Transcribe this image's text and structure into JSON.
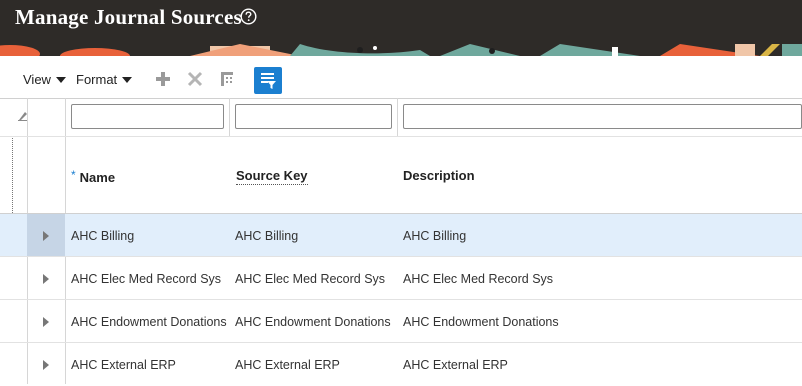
{
  "page": {
    "title": "Manage Journal Sources",
    "help_icon": "help-circle-icon"
  },
  "toolbar": {
    "view_label": "View",
    "format_label": "Format",
    "icons": [
      "add-icon",
      "delete-icon",
      "freeze-icon",
      "query-by-example-icon"
    ]
  },
  "table": {
    "columns": [
      {
        "key": "name",
        "label": "Name",
        "required_marker": "*"
      },
      {
        "key": "source_key",
        "label": "Source Key"
      },
      {
        "key": "description",
        "label": "Description"
      }
    ],
    "rows": [
      {
        "name": "AHC Billing",
        "source_key": "AHC Billing",
        "description": "AHC Billing",
        "selected": true
      },
      {
        "name": "AHC Elec Med Record Sys",
        "source_key": "AHC Elec Med Record Sys",
        "description": "AHC Elec Med Record Sys"
      },
      {
        "name": "AHC Endowment Donations",
        "source_key": "AHC Endowment Donations",
        "description": "AHC Endowment Donations"
      },
      {
        "name": "AHC External ERP",
        "source_key": "AHC External ERP",
        "description": "AHC External ERP"
      }
    ],
    "filters": {
      "name": "",
      "source_key": "",
      "description": ""
    }
  },
  "colors": {
    "header_bg": "#2e2b28",
    "accent": "#1b7fd0",
    "selected_row": "#e1eefb"
  }
}
